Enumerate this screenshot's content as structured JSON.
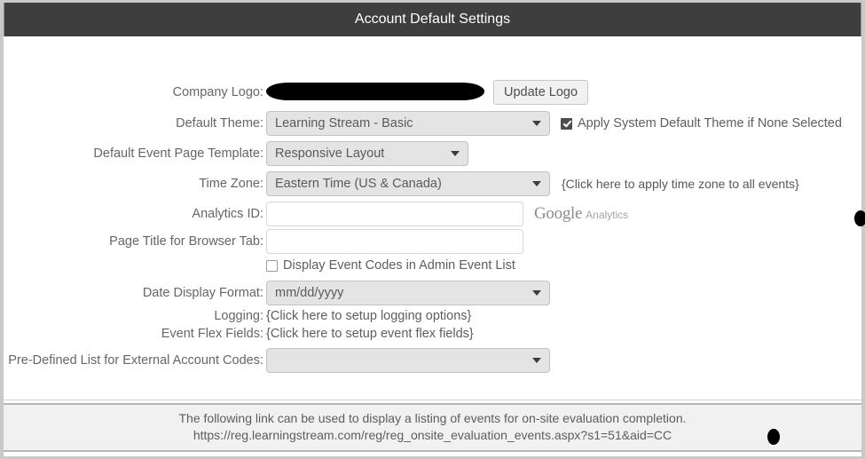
{
  "window": {
    "title": "Account Default Settings"
  },
  "form": {
    "company_logo": {
      "label": "Company Logo:",
      "update_button": "Update Logo"
    },
    "default_theme": {
      "label": "Default Theme:",
      "value": "Learning Stream - Basic",
      "apply_default_checkbox_label": "Apply System Default Theme if None Selected",
      "apply_default_checked": true
    },
    "event_page_template": {
      "label": "Default Event Page Template:",
      "value": "Responsive Layout"
    },
    "time_zone": {
      "label": "Time Zone:",
      "value": "Eastern Time (US & Canada)",
      "note": "{Click here to apply time zone to all events}"
    },
    "analytics_id": {
      "label": "Analytics ID:",
      "value": "",
      "placeholder": "",
      "brand_primary": "Google",
      "brand_secondary": "Analytics"
    },
    "page_title_browser_tab": {
      "label": "Page Title for Browser Tab:",
      "value": "",
      "placeholder": ""
    },
    "display_event_codes": {
      "checkbox_label": "Display Event Codes in Admin Event List",
      "checked": false
    },
    "date_display_format": {
      "label": "Date Display Format:",
      "value": "mm/dd/yyyy"
    },
    "logging": {
      "label": "Logging:",
      "link_text": "{Click here to setup logging options}"
    },
    "event_flex_fields": {
      "label": "Event Flex Fields:",
      "link_text": "{Click here to setup event flex fields}"
    },
    "predefined_list": {
      "label": "Pre-Defined List for External Account Codes:",
      "value": ""
    }
  },
  "footer": {
    "line1": "The following link can be used to display a listing of events for on-site evaluation completion.",
    "line2": "https://reg.learningstream.com/reg/reg_onsite_evaluation_events.aspx?s1=51&aid=CC"
  },
  "colors": {
    "title_bar_bg": "#3e3e3e",
    "title_bar_text": "#ffffff",
    "select_bg": "#e4e4e4",
    "page_bg": "#ffffff",
    "footer_bg": "#f1f1f1",
    "label_text": "#666666"
  }
}
